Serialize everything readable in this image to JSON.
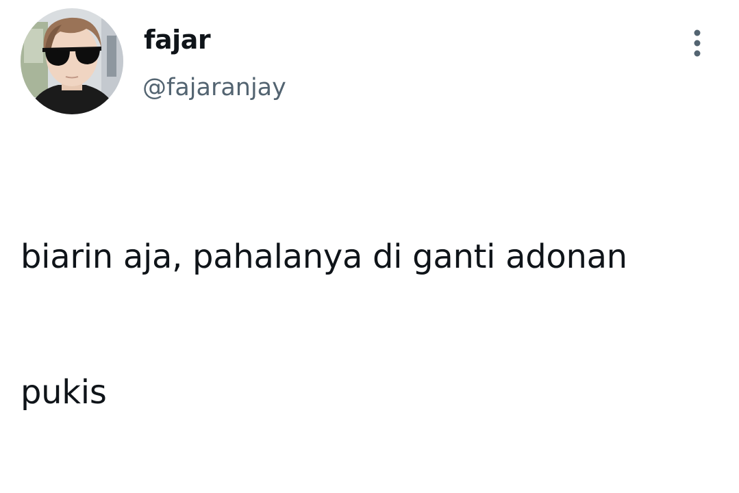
{
  "tweet": {
    "author": {
      "display_name": "fajar",
      "handle": "@fajaranjay",
      "avatar_icon": "profile-photo-sunglasses"
    },
    "more_icon": "more-vertical-icon",
    "text_lines": [
      "biarin aja, pahalanya di ganti adonan",
      "pukis"
    ]
  },
  "colors": {
    "name": "#0f1419",
    "handle": "#536471",
    "body_text": "#0f1419",
    "more_icon": "#536471"
  }
}
